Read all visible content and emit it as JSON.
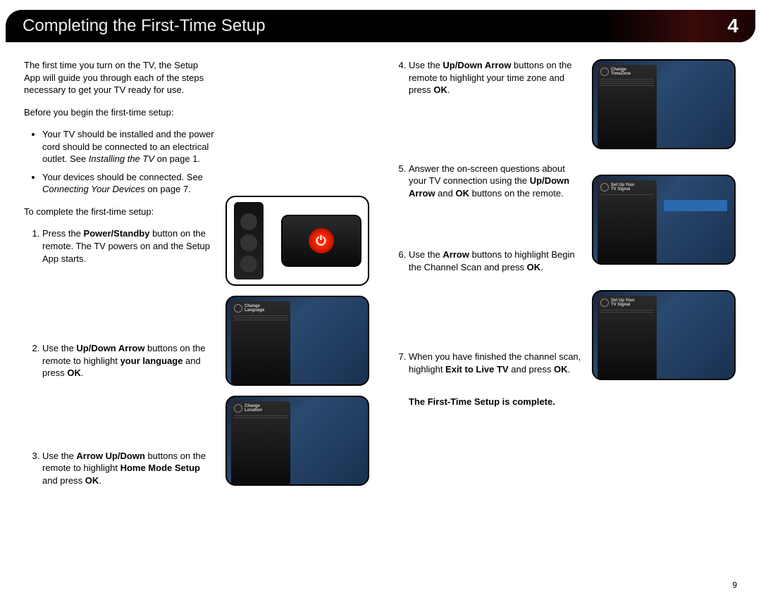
{
  "header": {
    "title": "Completing the First-Time Setup",
    "chapter_number": "4"
  },
  "intro": "The first time you turn on the TV, the Setup App will guide you through each of the steps necessary to get your TV ready for use.",
  "pre_heading": "Before you begin the first-time setup:",
  "pre_bullets": [
    {
      "text_a": "Your TV should be installed and the power cord should be connected to an electrical outlet. See ",
      "ref": "Installing the TV",
      "text_b": " on page 1."
    },
    {
      "text_a": "Your devices should be connected. See ",
      "ref": "Connecting Your Devices",
      "text_b": " on page 7."
    }
  ],
  "to_complete": "To complete the first-time setup:",
  "steps_left": [
    {
      "n": "1",
      "segments": [
        {
          "t": "Press the "
        },
        {
          "b": "Power/Standby"
        },
        {
          "t": " button on the remote. The TV powers on and the Setup App starts."
        }
      ]
    },
    {
      "n": "2",
      "segments": [
        {
          "t": "Use the "
        },
        {
          "b": "Up/Down Arrow"
        },
        {
          "t": " buttons on the remote to highlight "
        },
        {
          "b": "your language"
        },
        {
          "t": " and press "
        },
        {
          "b": "OK"
        },
        {
          "t": "."
        }
      ]
    },
    {
      "n": "3",
      "segments": [
        {
          "t": "Use the "
        },
        {
          "b": "Arrow Up/Down"
        },
        {
          "t": " buttons on the remote to highlight "
        },
        {
          "b": "Home Mode Setup"
        },
        {
          "t": " and press "
        },
        {
          "b": "OK"
        },
        {
          "t": "."
        }
      ]
    }
  ],
  "steps_right": [
    {
      "n": "4",
      "segments": [
        {
          "t": "Use the "
        },
        {
          "b": "Up/Down Arrow"
        },
        {
          "t": " buttons on the remote to highlight your time zone and press "
        },
        {
          "b": "OK"
        },
        {
          "t": "."
        }
      ]
    },
    {
      "n": "5",
      "segments": [
        {
          "t": "Answer the on-screen questions about your TV connection using the "
        },
        {
          "b": "Up/Down Arrow"
        },
        {
          "t": " and "
        },
        {
          "b": "OK"
        },
        {
          "t": " buttons on the remote."
        }
      ]
    },
    {
      "n": "6",
      "segments": [
        {
          "t": "Use the "
        },
        {
          "b": "Arrow"
        },
        {
          "t": " buttons to highlight Begin the Channel Scan and press "
        },
        {
          "b": "OK"
        },
        {
          "t": "."
        }
      ]
    },
    {
      "n": "7",
      "segments": [
        {
          "t": "When you have finished the channel scan, highlight "
        },
        {
          "b": "Exit to Live TV"
        },
        {
          "t": " and press "
        },
        {
          "b": "OK"
        },
        {
          "t": "."
        }
      ]
    }
  ],
  "menu_titles": {
    "language": "Change\nLanguage",
    "location": "Change\nLocation",
    "timezone": "Change\nTimeZone",
    "signal1": "Set Up Your\nTV Signal",
    "signal2": "Set Up Your\nTV Signal"
  },
  "complete_message": "The First-Time Setup is complete.",
  "page_number": "9"
}
